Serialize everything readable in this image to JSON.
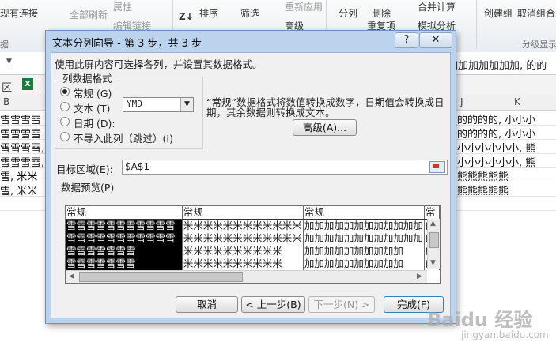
{
  "ribbon": {
    "existing_connections": "现有连接",
    "refresh_all": "全部刷新",
    "properties": "属性",
    "edit_links": "编辑链接",
    "sort_icon_text": "Z↓",
    "sort": "排序",
    "filter": "筛选",
    "reapply": "重新应用",
    "advanced": "高级",
    "text_to_columns": "分列",
    "remove": "删除",
    "remove_duplicates": "重复项",
    "consolidate": "合并计算",
    "what_if": "模拟分析",
    "group": "创建组",
    "ungroup": "取消组合",
    "outline_group": "分级显示",
    "data_group_fragment": "据"
  },
  "formula_bar": {
    "content": "加加加加加加加, 的的"
  },
  "sheet": {
    "left_label": "区",
    "excel_icon": "X",
    "columns": [
      "B",
      "J",
      "K"
    ],
    "left_cells": [
      "雪雪雪雪",
      "雪雪雪雪",
      "雪雪雪雪,",
      "雪雪雪雪,",
      "雪, 米米",
      "雪, 米米"
    ],
    "right_cells": [
      "的的的的, 小小小",
      "的的的的, 小小小",
      "小小小小小小, 熊",
      "小小小小小小, 熊",
      "熊熊熊熊熊",
      "熊熊熊熊熊"
    ]
  },
  "dialog": {
    "title": "文本分列向导 - 第 3 步，共 3 步",
    "help": "?",
    "close": "✕",
    "instruction": "使用此屏内容可选择各列，并设置其数据格式。",
    "format_group_label": "列数据格式",
    "format_options": [
      {
        "label": "常规 (G)",
        "checked": true
      },
      {
        "label": "文本 (T)",
        "checked": false
      },
      {
        "label": "日期 (D):",
        "checked": false
      },
      {
        "label": "不导入此列（跳过）(I)",
        "checked": false
      }
    ],
    "date_format": "YMD",
    "general_note": "“常规”数据格式将数值转换成数字，日期值会转换成日期，其余数据则转换成文本。",
    "advanced_button": "高级(A)...",
    "destination_label": "目标区域(E):",
    "destination_value": "$A$1",
    "preview_label": "数据预览(P)",
    "preview": {
      "headers": [
        "常规",
        "常规",
        "常规",
        "常"
      ],
      "rows": [
        [
          "雪雪雪雪雪雪雪雪雪雪雪",
          "米米米米米米米米米米米米",
          "加加加加加加加加加加加加",
          "的"
        ],
        [
          "雪雪雪雪雪雪雪雪雪雪雪",
          "米米米米米米米米米米米米",
          "加加加加加加加加加加加加",
          "的"
        ],
        [
          "雪雪雪雪雪雪雪",
          "米米米米米米米米米米",
          "加加加加加加加加加加",
          "的"
        ],
        [
          "雪雪雪雪雪雪雪",
          "米米米米米米米米米米",
          "加加加加加加加加加加",
          "的"
        ]
      ]
    },
    "buttons": {
      "cancel": "取消",
      "back": "< 上一步(B)",
      "next": "下一步(N) >",
      "finish": "完成(F)"
    }
  },
  "watermark": {
    "main": "Baidu 经验",
    "sub": "jingyan.baidu.com"
  }
}
